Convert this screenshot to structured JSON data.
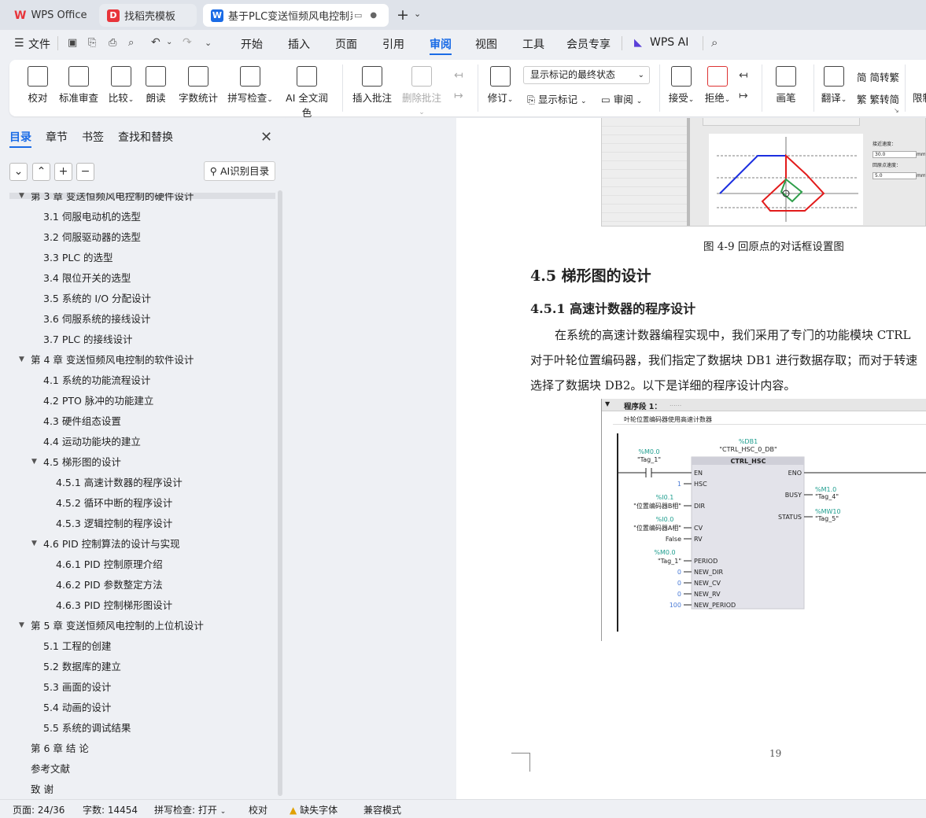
{
  "tabs": [
    {
      "label": "WPS Office",
      "active": false
    },
    {
      "label": "找稻壳模板",
      "active": false
    },
    {
      "label": "基于PLC变送恒频风电控制系",
      "active": true
    }
  ],
  "menu": {
    "file": "文件",
    "items": [
      "开始",
      "插入",
      "页面",
      "引用",
      "审阅",
      "视图",
      "工具",
      "会员专享"
    ],
    "active": "审阅",
    "ai": "WPS AI"
  },
  "ribbon": {
    "proofread": "校对",
    "std_review": "标准审查",
    "compare": "比较",
    "read_aloud": "朗读",
    "word_count": "字数统计",
    "spell_check": "拼写检查",
    "ai_polish": "AI 全文润色",
    "insert_comment": "插入批注",
    "delete_comment": "删除批注",
    "revise": "修订",
    "markup_select": "显示标记的最终状态",
    "show_markup": "显示标记",
    "review": "审阅",
    "accept": "接受",
    "reject": "拒绝",
    "pen": "画笔",
    "translate": "翻译",
    "to_trad": "简转繁",
    "to_simp": "繁转简",
    "restrict": "限制"
  },
  "sidebar": {
    "tabs": [
      "目录",
      "章节",
      "书签",
      "查找和替换"
    ],
    "ai_button": "AI识别目录",
    "toc": [
      {
        "text": "第 3 章  变送恒频风电控制的硬件设计",
        "level": 1,
        "expanded": true
      },
      {
        "text": "3.1  伺服电动机的选型",
        "level": 2
      },
      {
        "text": "3.2  伺服驱动器的选型",
        "level": 2
      },
      {
        "text": "3.3 PLC 的选型",
        "level": 2
      },
      {
        "text": "3.4  限位开关的选型",
        "level": 2
      },
      {
        "text": "3.5  系统的 I/O 分配设计",
        "level": 2
      },
      {
        "text": "3.6  伺服系统的接线设计",
        "level": 2
      },
      {
        "text": "3.7 PLC 的接线设计",
        "level": 2
      },
      {
        "text": "第 4 章  变送恒频风电控制的软件设计",
        "level": 1,
        "expanded": true
      },
      {
        "text": "4.1  系统的功能流程设计",
        "level": 2
      },
      {
        "text": "4.2 PTO 脉冲的功能建立",
        "level": 2
      },
      {
        "text": "4.3  硬件组态设置",
        "level": 2
      },
      {
        "text": "4.4  运动功能块的建立",
        "level": 2
      },
      {
        "text": "4.5  梯形图的设计",
        "level": 2,
        "expanded": true
      },
      {
        "text": "4.5.1  高速计数器的程序设计",
        "level": 3
      },
      {
        "text": "4.5.2  循环中断的程序设计",
        "level": 3
      },
      {
        "text": "4.5.3  逻辑控制的程序设计",
        "level": 3
      },
      {
        "text": "4.6 PID 控制算法的设计与实现",
        "level": 2,
        "expanded": true
      },
      {
        "text": "4.6.1 PID 控制原理介绍",
        "level": 3
      },
      {
        "text": "4.6.2 PID 参数整定方法",
        "level": 3
      },
      {
        "text": "4.6.3 PID 控制梯形图设计",
        "level": 3
      },
      {
        "text": "第 5 章  变送恒频风电控制的上位机设计",
        "level": 1,
        "expanded": true
      },
      {
        "text": "5.1  工程的创建",
        "level": 2
      },
      {
        "text": "5.2  数据库的建立",
        "level": 2
      },
      {
        "text": "5.3  画面的设计",
        "level": 2
      },
      {
        "text": "5.4  动画的设计",
        "level": 2
      },
      {
        "text": "5.5  系统的调试结果",
        "level": 2
      },
      {
        "text": "第 6 章  结    论",
        "level": 1
      },
      {
        "text": "参考文献",
        "level": 1
      },
      {
        "text": "致    谢",
        "level": 1
      }
    ]
  },
  "doc": {
    "fig_caption": "图 4-9  回原点的对话框设置图",
    "fig_labels": {
      "speed": "接近速度：",
      "speed_val": "30.0",
      "unit": "mm",
      "home": "回原点速度：",
      "home_val": "5.0"
    },
    "h2": "4.5  梯形图的设计",
    "h3": "4.5.1  高速计数器的程序设计",
    "p1": "在系统的高速计数器编程实现中，我们采用了专门的功能模块 CTRL",
    "p2": "对于叶轮位置编码器，我们指定了数据块 DB1 进行数据存取；而对于转速",
    "p3": "选择了数据块 DB2。以下是详细的程序设计内容。",
    "ladder": {
      "segment": "程序段 1：",
      "segment_dots": "......",
      "comment": "叶轮位置编码器使用高速计数器",
      "db_addr": "%DB1",
      "db_name": "\"CTRL_HSC_0_DB\"",
      "block": "CTRL_HSC",
      "contact_addr": "%M0.0",
      "contact_tag": "\"Tag_1\"",
      "en": "EN",
      "eno": "ENO",
      "inputs": [
        {
          "addr": "",
          "val": "1",
          "pin": "HSC"
        },
        {
          "addr": "%I0.1",
          "val": "\"位置编码器B相\"",
          "pin": "DIR"
        },
        {
          "addr": "%I0.0",
          "val": "\"位置编码器A相\"",
          "pin": "CV"
        },
        {
          "addr": "",
          "val": "False",
          "pin": "RV"
        },
        {
          "addr": "%M0.0",
          "val": "\"Tag_1\"",
          "pin": "PERIOD"
        },
        {
          "addr": "",
          "val": "0",
          "pin": "NEW_DIR"
        },
        {
          "addr": "",
          "val": "0",
          "pin": "NEW_CV"
        },
        {
          "addr": "",
          "val": "0",
          "pin": "NEW_RV"
        },
        {
          "addr": "",
          "val": "100",
          "pin": "NEW_PERIOD"
        }
      ],
      "outputs": [
        {
          "pin": "BUSY",
          "addr": "%M1.0",
          "val": "\"Tag_4\""
        },
        {
          "pin": "STATUS",
          "addr": "%MW10",
          "val": "\"Tag_5\""
        }
      ]
    },
    "page_number": "19"
  },
  "status": {
    "page": "页面: 24/36",
    "words": "字数: 14454",
    "spell": "拼写检查: 打开",
    "proof": "校对",
    "missing_font": "缺失字体",
    "compat": "兼容模式"
  },
  "colors": {
    "accent": "#1a6be6",
    "wps_red": "#e8343a"
  }
}
